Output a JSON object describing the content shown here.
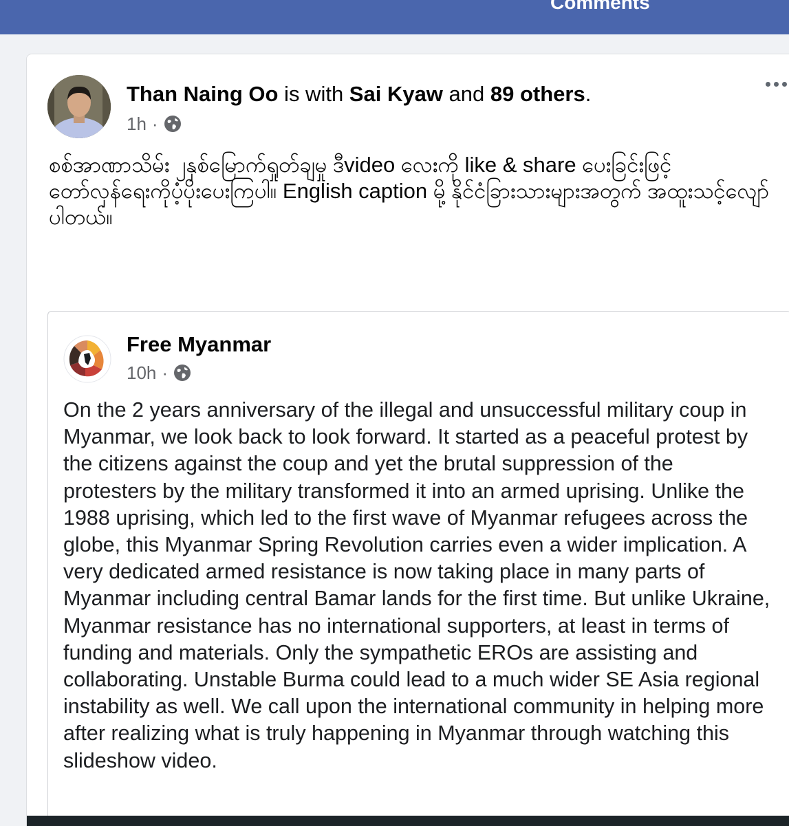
{
  "topbar": {
    "title": "Comments"
  },
  "post": {
    "author": "Than Naing Oo",
    "with_text": " is with ",
    "tagged": "Sai Kyaw",
    "and_text": " and ",
    "others": "89 others",
    "period": ".",
    "time": "1h",
    "separator": "·",
    "audience_icon": "globe-icon",
    "more_icon": "more-options-icon",
    "text": "စစ်အာဏာသိမ်း ၂နှစ်မြောက်ရှုတ်ချမှု ဒီvideo လေးကို like & share ပေးခြင်းဖြင့် တော်လှန်ရေးကိုပံ့ပိုးပေးကြပါ။ English caption မို့ နိုင်ငံခြားသားများအတွက် အထူးသင့်လျော်ပါတယ်။"
  },
  "shared_post": {
    "page_name": "Free Myanmar",
    "time": "10h",
    "separator": "·",
    "audience_icon": "globe-icon",
    "text": "On the 2 years anniversary of the illegal and unsuccessful military coup in Myanmar, we look back to look forward. It started as a peaceful protest by the citizens against the coup and yet the brutal suppression of the protesters by the military transformed it into an armed uprising. Unlike the 1988 uprising, which led to the first wave of Myanmar refugees across the globe, this Myanmar Spring Revolution carries even a wider implication. A very dedicated armed resistance is now taking place in many parts of Myanmar including central Bamar lands for the first time. But unlike Ukraine, Myanmar resistance has no international supporters, at least in terms of funding and materials. Only the sympathetic EROs are assisting and collaborating. Unstable Burma could lead to a much wider SE Asia regional instability as well. We call upon the international community in helping more after realizing what is truly happening in Myanmar through watching this slideshow video."
  },
  "colors": {
    "topbar": "#4a66ad",
    "background": "#f0f2f5",
    "meta_text": "#65676b"
  }
}
